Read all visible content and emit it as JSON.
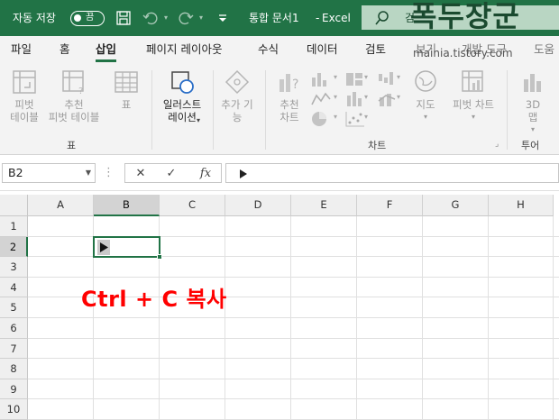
{
  "titlebar": {
    "autosave_label": "자동 저장",
    "autosave_toggle": "끔",
    "doc_title": "통합 문서1",
    "app_separator": "-",
    "app_name": "Excel",
    "search_text": "검",
    "watermark": "폭두장군"
  },
  "tabs": [
    "파일",
    "홈",
    "삽입",
    "페이지 레이아웃",
    "수식",
    "데이터",
    "검토",
    "보기",
    "개발 도구",
    "도움"
  ],
  "active_tab": "삽입",
  "watermark_url": "mainia.tistory.com",
  "ribbon": {
    "pivot_table": [
      "피벗",
      "테이블"
    ],
    "recommended_pivot": [
      "추천",
      "피벗 테이블"
    ],
    "table": [
      "표"
    ],
    "illustrations": [
      "일러스트",
      "레이션"
    ],
    "addins": [
      "추가 기",
      "능"
    ],
    "recommended_charts": [
      "추천",
      "차트"
    ],
    "maps": [
      "지도"
    ],
    "pivot_chart": [
      "피벗 차트"
    ],
    "map_3d": [
      "3D",
      "맵"
    ],
    "group_table": "표",
    "group_charts": "차트",
    "group_tours": "투어"
  },
  "formula_bar": {
    "name_box": "B2",
    "cancel": "✕",
    "enter": "✓",
    "fx": "fx",
    "formula": ""
  },
  "sheet": {
    "columns": [
      "A",
      "B",
      "C",
      "D",
      "E",
      "F",
      "G",
      "H"
    ],
    "rows": [
      "1",
      "2",
      "3",
      "4",
      "5",
      "6",
      "7",
      "8",
      "9",
      "10"
    ],
    "active_cell": "B2"
  },
  "annotation": "Ctrl + C 복사",
  "colors": {
    "excel_green": "#217346",
    "annotation_red": "#ff0000"
  }
}
